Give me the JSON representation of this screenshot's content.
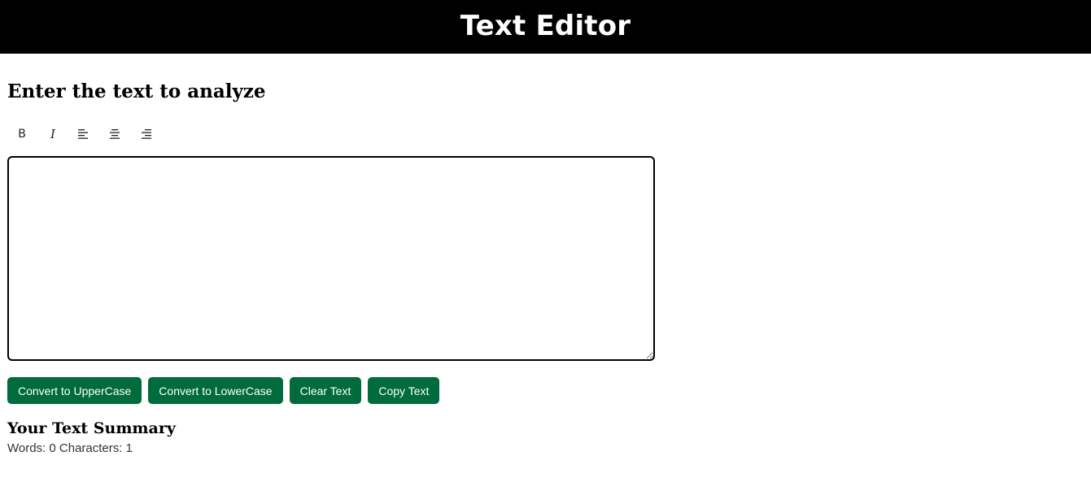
{
  "header": {
    "title": "Text Editor",
    "background": "#000000"
  },
  "main": {
    "heading": "Enter the text to analyze",
    "toolbar": {
      "bold_label": "B",
      "italic_label": "I",
      "icons": [
        "bold-icon",
        "italic-icon",
        "align-left-icon",
        "align-center-icon",
        "align-right-icon"
      ]
    },
    "editor": {
      "value": ""
    },
    "buttons": {
      "uppercase": "Convert to UpperCase",
      "lowercase": "Convert to LowerCase",
      "clear": "Clear Text",
      "copy": "Copy Text"
    },
    "accent_color": "#006b3c"
  },
  "summary": {
    "title": "Your Text Summary",
    "stats": "Words: 0 Characters: 1"
  }
}
